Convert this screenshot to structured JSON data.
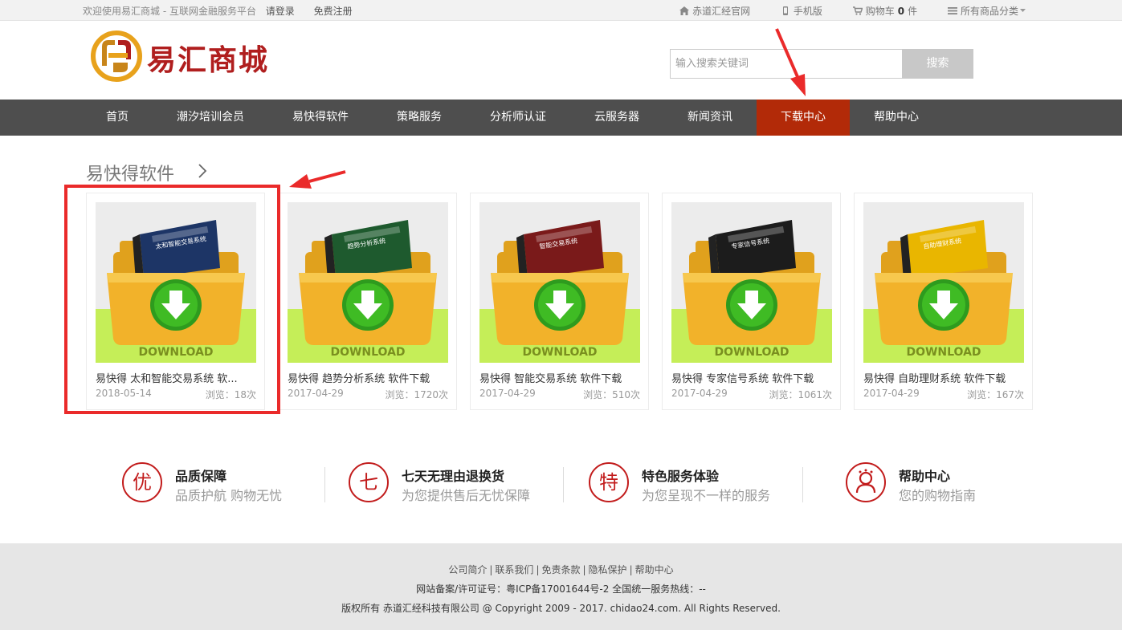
{
  "topbar": {
    "welcome": "欢迎使用易汇商城 - 互联网金融服务平台",
    "login": "请登录",
    "register": "免费注册",
    "official_site": "赤道汇经官网",
    "mobile": "手机版",
    "cart_label": "购物车",
    "cart_count": "0",
    "cart_unit": "件",
    "categories": "所有商品分类"
  },
  "header": {
    "logo_text": "易汇商城",
    "search_placeholder": "输入搜索关键词",
    "search_button": "搜索"
  },
  "nav": {
    "items": [
      "首页",
      "潮汐培训会员",
      "易快得软件",
      "策略服务",
      "分析师认证",
      "云服务器",
      "新闻资讯",
      "下载中心",
      "帮助中心"
    ],
    "active": "下载中心"
  },
  "section": {
    "title": "易快得软件"
  },
  "products": [
    {
      "title": "易快得 太和智能交易系统 软...",
      "date": "2018-05-14",
      "views": "浏览：18次",
      "box_color": "#1d3566",
      "box_label": "太和智能交易系统"
    },
    {
      "title": "易快得 趋势分析系统 软件下载",
      "date": "2017-04-29",
      "views": "浏览：1720次",
      "box_color": "#1e5a2e",
      "box_label": "趋势分析系统"
    },
    {
      "title": "易快得 智能交易系统 软件下载",
      "date": "2017-04-29",
      "views": "浏览：510次",
      "box_color": "#7a1a1a",
      "box_label": "智能交易系统"
    },
    {
      "title": "易快得 专家信号系统 软件下载",
      "date": "2017-04-29",
      "views": "浏览：1061次",
      "box_color": "#1c1c1c",
      "box_label": "专家信号系统"
    },
    {
      "title": "易快得 自助理财系统 软件下载",
      "date": "2017-04-29",
      "views": "浏览：167次",
      "box_color": "#e9b600",
      "box_label": "自助理财系统"
    }
  ],
  "download_label": "DOWNLOAD",
  "features": [
    {
      "icon_char": "优",
      "title": "品质保障",
      "subtitle": "品质护航 购物无忧"
    },
    {
      "icon_char": "七",
      "title": "七天无理由退换货",
      "subtitle": "为您提供售后无忧保障"
    },
    {
      "icon_char": "特",
      "title": "特色服务体验",
      "subtitle": "为您呈现不一样的服务"
    },
    {
      "icon_char": "",
      "title": "帮助中心",
      "subtitle": "您的购物指南"
    }
  ],
  "footer": {
    "links": [
      "公司简介",
      "联系我们",
      "免责条款",
      "隐私保护",
      "帮助中心"
    ],
    "license": "网站备案/许可证号：粤ICP备17001644号-2 全国统一服务热线：--",
    "copyright": "版权所有 赤道汇经科技有限公司 @ Copyright 2009 - 2017. chidao24.com. All Rights Reserved."
  },
  "colors": {
    "nav_bg": "#4e4e4e",
    "nav_active": "#b22a08",
    "brand_red": "#b01e1e",
    "highlight_red": "#ea2a2a",
    "download_green": "#c5ee58"
  }
}
